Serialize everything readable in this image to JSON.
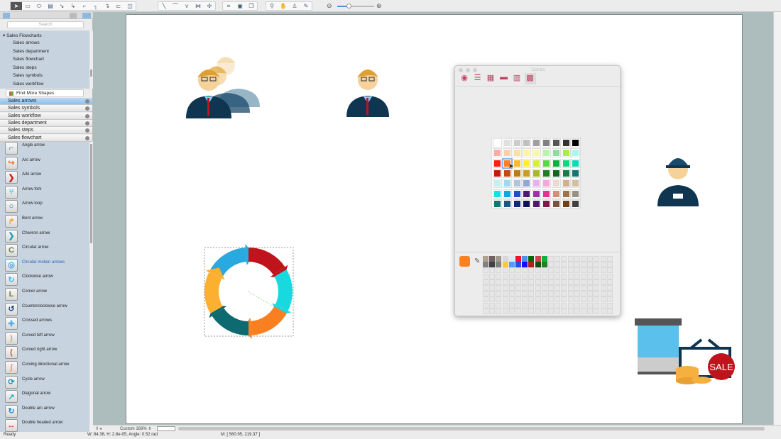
{
  "toolbar": {
    "groups": [
      [
        "pointer-icon",
        "rectangle-icon",
        "ellipse-icon",
        "text-box-icon",
        "connector-icon",
        "curved-connector-icon",
        "orthogonal-connector-icon",
        "elbow-connector-icon",
        "round-connector-icon",
        "tree-connector-icon",
        "container-icon"
      ],
      [
        "line-icon",
        "arc-icon",
        "polyline-icon",
        "bezier-icon",
        "spline-icon"
      ],
      [
        "snap-icon",
        "group-icon",
        "layers-icon"
      ],
      [
        "zoom-icon",
        "hand-icon",
        "stamp-icon",
        "eyedropper-icon"
      ]
    ],
    "zoom_out": "zoom-out-icon",
    "zoom_in": "zoom-in-icon",
    "zoom_level": 0.3
  },
  "sidebar": {
    "search_placeholder": "Search",
    "tree_title": "Sales Flowcharts",
    "tree_items": [
      "Sales arrows",
      "Sales department",
      "Sales flowchart",
      "Sales steps",
      "Sales symbols",
      "Sales workflow"
    ],
    "find_more": "Find More Shapes",
    "libraries": [
      "Sales arrows",
      "Sales symbols",
      "Sales workflow",
      "Sales department",
      "Sales steps",
      "Sales flowchart"
    ],
    "shapes": [
      {
        "label": "Angle arrow",
        "glyph": "⌐",
        "color": "#2a8ac8"
      },
      {
        "label": "Arc arrow",
        "glyph": "↪",
        "color": "#f07020"
      },
      {
        "label": "Arki arrow",
        "glyph": "❯",
        "color": "#c82020"
      },
      {
        "label": "Arrow fork",
        "glyph": "⑂",
        "color": "#40b8e8"
      },
      {
        "label": "Arrow loop",
        "glyph": "○",
        "color": "#1a6a80"
      },
      {
        "label": "Bent arrow",
        "glyph": "↱",
        "color": "#f8a030"
      },
      {
        "label": "Chevron arrow",
        "glyph": "❯",
        "color": "#20a0b0"
      },
      {
        "label": "Circular arrow",
        "glyph": "C",
        "color": "#708050"
      },
      {
        "label": "Circular motion arrows",
        "glyph": "◎",
        "color": "#40a8e0"
      },
      {
        "label": "Clockwise arrow",
        "glyph": "↻",
        "color": "#40b8e8"
      },
      {
        "label": "Corner arrow",
        "glyph": "L",
        "color": "#708040"
      },
      {
        "label": "Counterclockwise arrow",
        "glyph": "↺",
        "color": "#1a4a80"
      },
      {
        "label": "Crossed arrows",
        "glyph": "✚",
        "color": "#40b8e8"
      },
      {
        "label": "Curved left arrow",
        "glyph": ")",
        "color": "#f0a030"
      },
      {
        "label": "Curved right arrow",
        "glyph": "(",
        "color": "#c06020"
      },
      {
        "label": "Curving directional arrow",
        "glyph": "∫",
        "color": "#f8a030"
      },
      {
        "label": "Cycle arrow",
        "glyph": "⟳",
        "color": "#2090b0"
      },
      {
        "label": "Diagonal arrow",
        "glyph": "↗",
        "color": "#20b0c0"
      },
      {
        "label": "Double arc arrow",
        "glyph": "↻",
        "color": "#2090c8"
      },
      {
        "label": "Double headed arrow",
        "glyph": "↔",
        "color": "#d02020"
      }
    ],
    "selected_shape": "Circular motion arrows"
  },
  "bottom": {
    "zoom": "Custom 168%"
  },
  "status": {
    "ready": "Ready",
    "geometry": "W: 84.36,  H: 2.8e-05,  Angle: 0.52 rad",
    "mouse": "M: [ 560.95, 219.37 ]"
  },
  "colors_panel": {
    "title": "Colors",
    "modes": [
      "color-wheel-icon",
      "sliders-icon",
      "palettes-icon",
      "image-palette-icon",
      "crayons-icon",
      "swatch-grid-icon"
    ],
    "current_color": "#ff8020",
    "selected_swatch": "#ff8020",
    "grid": [
      [
        "#ffffff",
        "#e0e0e0",
        "#cccccc",
        "#bfbfbf",
        "#a0a0a0",
        "#808080",
        "#555555",
        "#333333",
        "#000000"
      ],
      [
        "#ffaaa8",
        "#fdd0a8",
        "#fae0a8",
        "#fdf5a0",
        "#f8f8a8",
        "#b8f5a8",
        "#90dca0",
        "#a8f040",
        "#a8f8e8"
      ],
      [
        "#ff2010",
        "#ff8020",
        "#ffb830",
        "#ffee30",
        "#d8ee30",
        "#58d848",
        "#10b040",
        "#10d880",
        "#10d8b8"
      ],
      [
        "#c81808",
        "#c84810",
        "#c07818",
        "#c8a020",
        "#a8b828",
        "#208020",
        "#106820",
        "#108048",
        "#107870"
      ],
      [
        "#c0f0f0",
        "#a0d8f0",
        "#b0c4e0",
        "#90a8d8",
        "#e8b0f0",
        "#f8a8d8",
        "#f0d8d0",
        "#d0b090",
        "#d0c0a0"
      ],
      [
        "#10e0e8",
        "#10a8e0",
        "#2050c8",
        "#501870",
        "#a030b0",
        "#e83090",
        "#d09078",
        "#a07048",
        "#989080"
      ],
      [
        "#107870",
        "#1a5880",
        "#102880",
        "#101058",
        "#501870",
        "#801848",
        "#7a5040",
        "#704018",
        "#404040"
      ]
    ],
    "favorites": [
      [
        "#b0a090",
        "#706060",
        "#a09890",
        "#d8d8d8",
        "#e0e8f0",
        "#f01030",
        "#5090f0",
        "#106010",
        "#d04050",
        "#10b040"
      ],
      [
        "#808080",
        "#404048",
        "#808080",
        "#ffc840",
        "#50a0f8",
        "#2050f0",
        "#1010f0",
        "#b02020",
        "#105010",
        "#208020"
      ]
    ]
  },
  "canvas": {
    "sale_label": "SALE",
    "cycle_colors": [
      "#29a9e0",
      "#c0141c",
      "#18d8e0",
      "#f98020",
      "#0c6a70",
      "#fbb030"
    ]
  }
}
